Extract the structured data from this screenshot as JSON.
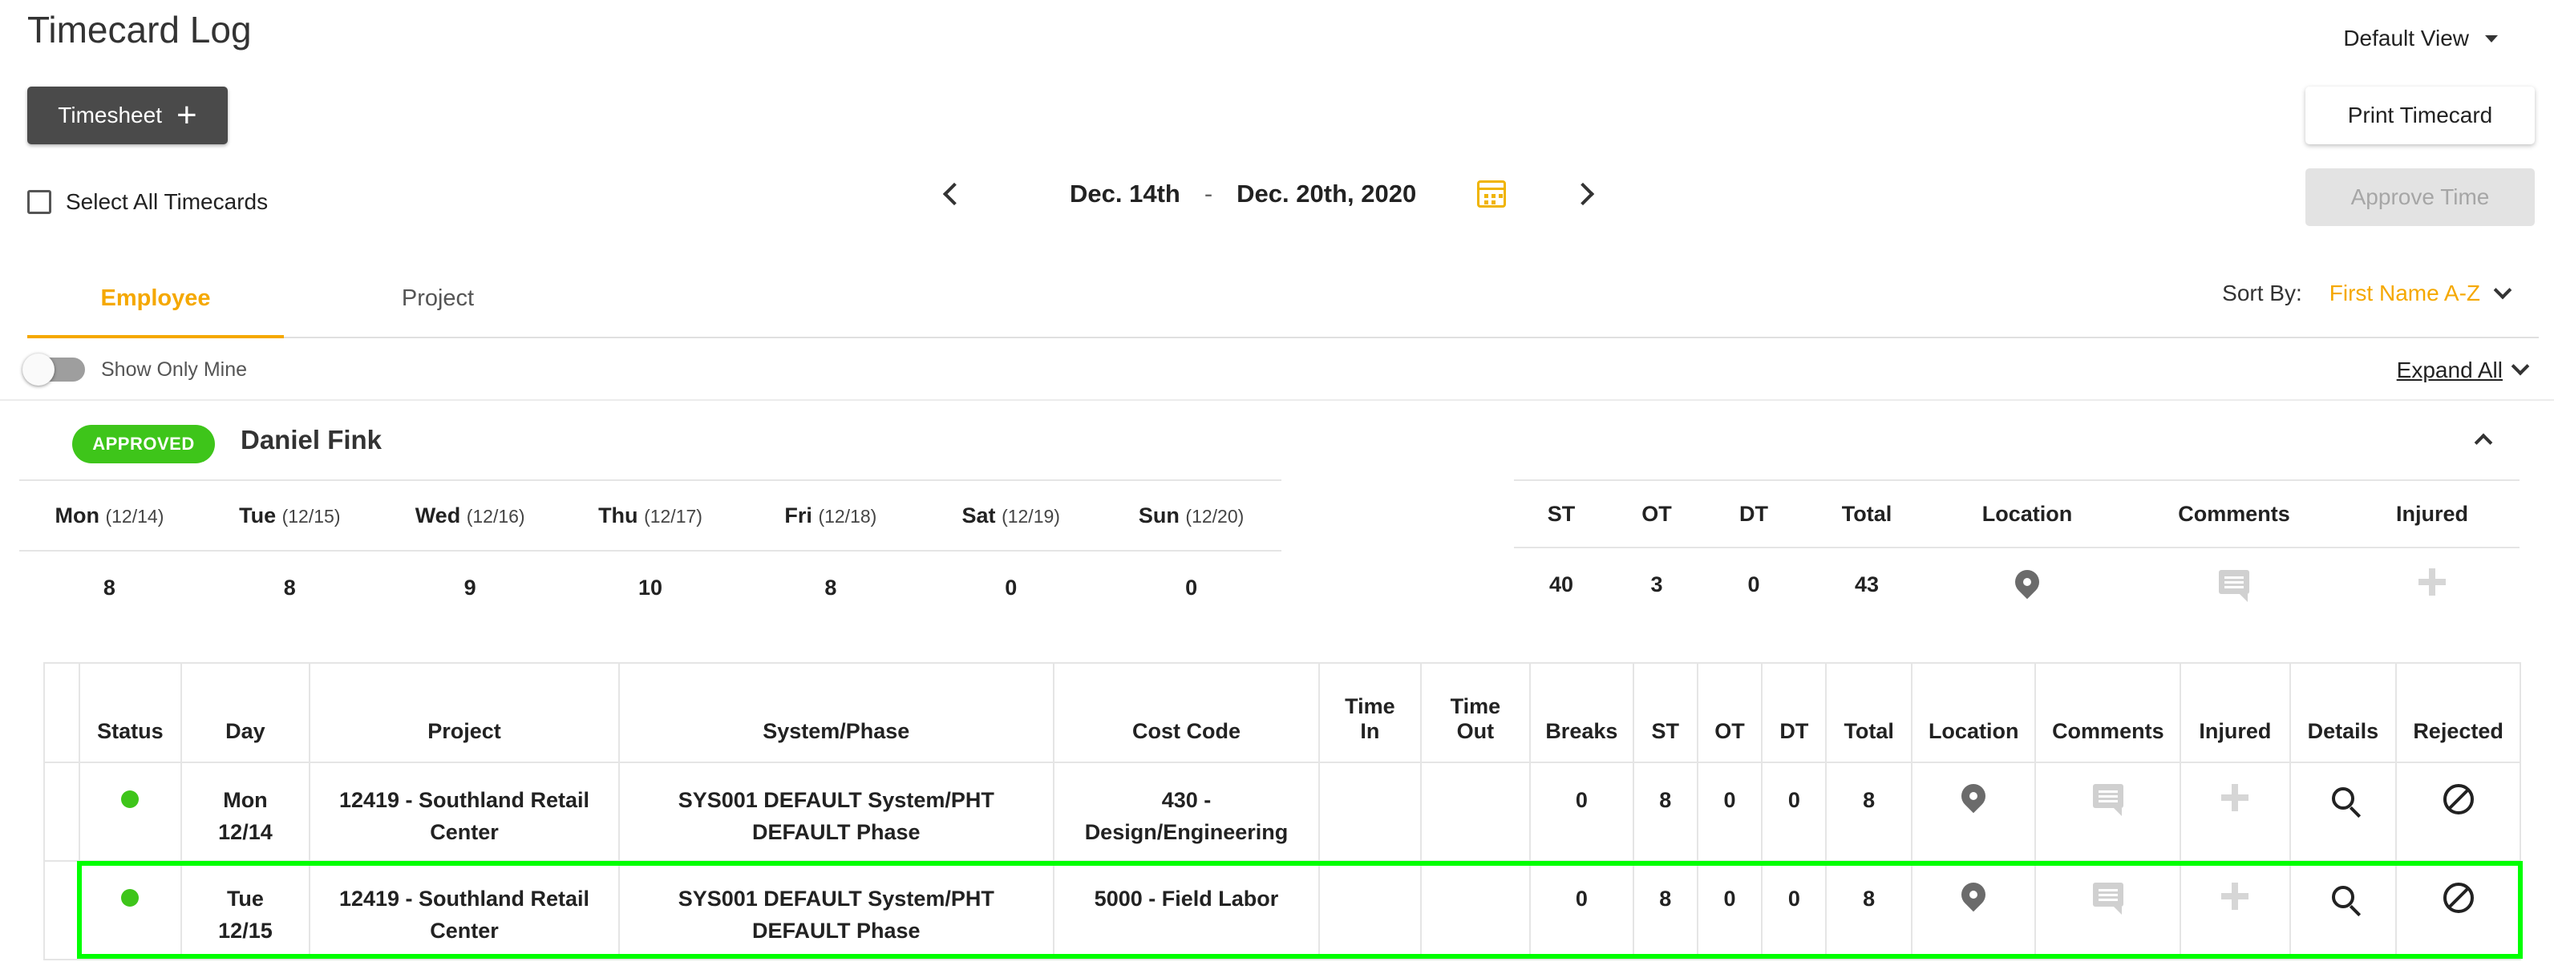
{
  "page": {
    "title": "Timecard Log"
  },
  "view_selector": {
    "label": "Default View"
  },
  "toolbar": {
    "timesheet_label": "Timesheet",
    "print_label": "Print Timecard",
    "approve_label": "Approve Time",
    "select_all_label": "Select All Timecards"
  },
  "date_range": {
    "start": "Dec. 14th",
    "separator": "-",
    "end": "Dec. 20th, 2020"
  },
  "tabs": {
    "employee": "Employee",
    "project": "Project"
  },
  "sort": {
    "label": "Sort By:",
    "value": "First Name A-Z"
  },
  "filters": {
    "show_only_mine": "Show Only Mine",
    "expand_all": "Expand All"
  },
  "employee": {
    "status": "APPROVED",
    "name": "Daniel Fink",
    "week": [
      {
        "day": "Mon",
        "date": "(12/14)",
        "hours": "8"
      },
      {
        "day": "Tue",
        "date": "(12/15)",
        "hours": "8"
      },
      {
        "day": "Wed",
        "date": "(12/16)",
        "hours": "9"
      },
      {
        "day": "Thu",
        "date": "(12/17)",
        "hours": "10"
      },
      {
        "day": "Fri",
        "date": "(12/18)",
        "hours": "8"
      },
      {
        "day": "Sat",
        "date": "(12/19)",
        "hours": "0"
      },
      {
        "day": "Sun",
        "date": "(12/20)",
        "hours": "0"
      }
    ],
    "summary": {
      "headers": {
        "st": "ST",
        "ot": "OT",
        "dt": "DT",
        "total": "Total",
        "location": "Location",
        "comments": "Comments",
        "injured": "Injured"
      },
      "values": {
        "st": "40",
        "ot": "3",
        "dt": "0",
        "total": "43"
      }
    }
  },
  "detail": {
    "headers": {
      "status": "Status",
      "day": "Day",
      "project": "Project",
      "system_phase": "System/Phase",
      "cost_code": "Cost Code",
      "time_in_1": "Time",
      "time_in_2": "In",
      "time_out_1": "Time",
      "time_out_2": "Out",
      "breaks": "Breaks",
      "st": "ST",
      "ot": "OT",
      "dt": "DT",
      "total": "Total",
      "location": "Location",
      "comments": "Comments",
      "injured": "Injured",
      "details": "Details",
      "rejected": "Rejected"
    },
    "rows": [
      {
        "day_1": "Mon",
        "day_2": "12/14",
        "project_1": "12419 - Southland Retail",
        "project_2": "Center",
        "system_1": "SYS001 DEFAULT System/PHT",
        "system_2": "DEFAULT Phase",
        "cost_1": "430 -",
        "cost_2": "Design/Engineering",
        "time_in": "",
        "time_out": "",
        "breaks": "0",
        "st": "8",
        "ot": "0",
        "dt": "0",
        "total": "8"
      },
      {
        "day_1": "Tue",
        "day_2": "12/15",
        "project_1": "12419 - Southland Retail",
        "project_2": "Center",
        "system_1": "SYS001 DEFAULT System/PHT",
        "system_2": "DEFAULT Phase",
        "cost_1": "5000 - Field Labor",
        "cost_2": "",
        "time_in": "",
        "time_out": "",
        "breaks": "0",
        "st": "8",
        "ot": "0",
        "dt": "0",
        "total": "8"
      }
    ]
  },
  "colors": {
    "accent": "#f5a800",
    "approved": "#3ec51a",
    "dark_button": "#4a4a4a",
    "highlight": "#00ff00"
  }
}
